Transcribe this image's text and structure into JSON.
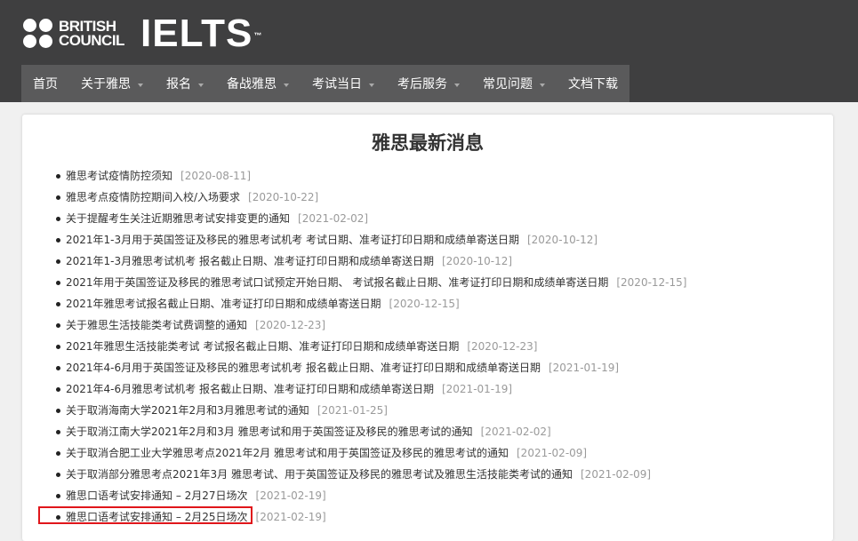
{
  "brand": {
    "bc_line1": "BRITISH",
    "bc_line2": "COUNCIL",
    "ielts": "IELTS",
    "tm": "™"
  },
  "nav": [
    {
      "label": "首页",
      "has_caret": false
    },
    {
      "label": "关于雅思",
      "has_caret": true
    },
    {
      "label": "报名",
      "has_caret": true
    },
    {
      "label": "备战雅思",
      "has_caret": true
    },
    {
      "label": "考试当日",
      "has_caret": true
    },
    {
      "label": "考后服务",
      "has_caret": true
    },
    {
      "label": "常见问题",
      "has_caret": true
    },
    {
      "label": "文档下载",
      "has_caret": false
    }
  ],
  "page_title": "雅思最新消息",
  "news": [
    {
      "text": "雅思考试疫情防控须知",
      "date": "[2020-08-11]"
    },
    {
      "text": "雅思考点疫情防控期间入校/入场要求",
      "date": "[2020-10-22]"
    },
    {
      "text": "关于提醒考生关注近期雅思考试安排变更的通知",
      "date": "[2021-02-02]"
    },
    {
      "text": "2021年1-3月用于英国签证及移民的雅思考试机考 考试日期、准考证打印日期和成绩单寄送日期",
      "date": "[2020-10-12]"
    },
    {
      "text": "2021年1-3月雅思考试机考 报名截止日期、准考证打印日期和成绩单寄送日期",
      "date": "[2020-10-12]"
    },
    {
      "text": "2021年用于英国签证及移民的雅思考试口试预定开始日期、 考试报名截止日期、准考证打印日期和成绩单寄送日期",
      "date": "[2020-12-15]"
    },
    {
      "text": "2021年雅思考试报名截止日期、准考证打印日期和成绩单寄送日期",
      "date": "[2020-12-15]"
    },
    {
      "text": "关于雅思生活技能类考试费调整的通知",
      "date": "[2020-12-23]"
    },
    {
      "text": "2021年雅思生活技能类考试 考试报名截止日期、准考证打印日期和成绩单寄送日期",
      "date": "[2020-12-23]"
    },
    {
      "text": "2021年4-6月用于英国签证及移民的雅思考试机考 报名截止日期、准考证打印日期和成绩单寄送日期",
      "date": "[2021-01-19]"
    },
    {
      "text": "2021年4-6月雅思考试机考 报名截止日期、准考证打印日期和成绩单寄送日期",
      "date": "[2021-01-19]"
    },
    {
      "text": "关于取消海南大学2021年2月和3月雅思考试的通知",
      "date": "[2021-01-25]"
    },
    {
      "text": "关于取消江南大学2021年2月和3月 雅思考试和用于英国签证及移民的雅思考试的通知",
      "date": "[2021-02-02]"
    },
    {
      "text": "关于取消合肥工业大学雅思考点2021年2月 雅思考试和用于英国签证及移民的雅思考试的通知",
      "date": "[2021-02-09]"
    },
    {
      "text": "关于取消部分雅思考点2021年3月 雅思考试、用于英国签证及移民的雅思考试及雅思生活技能类考试的通知",
      "date": "[2021-02-09]"
    },
    {
      "text": "雅思口语考试安排通知 – 2月27日场次",
      "date": "[2021-02-19]"
    },
    {
      "text": "雅思口语考试安排通知 – 2月25日场次",
      "date": "[2021-02-19]",
      "highlighted": true
    }
  ],
  "colors": {
    "header_bg": "#3f3f40",
    "nav_bg": "#5a5a5b",
    "highlight_border": "#e0161b",
    "date_text": "#9a9a9a"
  }
}
